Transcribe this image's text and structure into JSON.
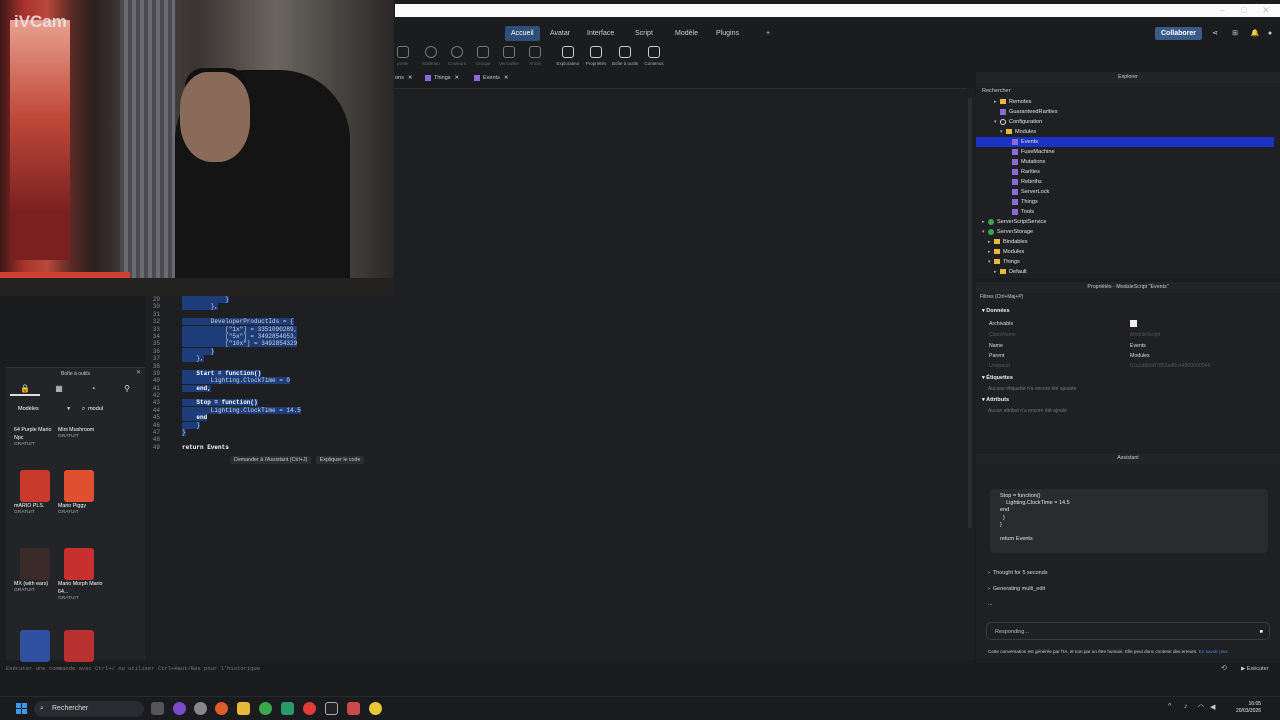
{
  "webcam": {
    "brand": "iVCam"
  },
  "menu": {
    "tabs": [
      "Accueil",
      "Avatar",
      "Interface",
      "Script",
      "Modèle",
      "Plugins"
    ],
    "add": "+",
    "collab": "Collaborer"
  },
  "ribbon": {
    "items": [
      "porter",
      "Matériau",
      "Couleurs",
      "Groupe",
      "Verrouiller",
      "Ancré",
      "Explorateur",
      "Propriétés",
      "Boîte à outils",
      "Contenus"
    ]
  },
  "doctabs": [
    {
      "label": "ons"
    },
    {
      "label": "Things"
    },
    {
      "label": "Events"
    }
  ],
  "code": {
    "lines": [
      {
        "n": "29",
        "t": "            }"
      },
      {
        "n": "30",
        "t": "        },"
      },
      {
        "n": "31",
        "t": ""
      },
      {
        "n": "32",
        "t": "        DeveloperProductIds = {"
      },
      {
        "n": "33",
        "t": "            [\"1x\"] = 3351090289,"
      },
      {
        "n": "34",
        "t": "            [\"5x\"] = 3492854053,"
      },
      {
        "n": "35",
        "t": "            [\"10x\"] = 3492854329"
      },
      {
        "n": "36",
        "t": "        }"
      },
      {
        "n": "37",
        "t": "    },"
      },
      {
        "n": "38",
        "t": ""
      },
      {
        "n": "39",
        "t": "    Start = function()"
      },
      {
        "n": "40",
        "t": "        Lighting.ClockTime = 0"
      },
      {
        "n": "41",
        "t": "    end,"
      },
      {
        "n": "42",
        "t": ""
      },
      {
        "n": "43",
        "t": "    Stop = function()"
      },
      {
        "n": "44",
        "t": "        Lighting.ClockTime = 14.5"
      },
      {
        "n": "45",
        "t": "    end"
      },
      {
        "n": "46",
        "t": "    }"
      },
      {
        "n": "47",
        "t": "}"
      },
      {
        "n": "48",
        "t": ""
      },
      {
        "n": "49",
        "t": "return Events"
      }
    ],
    "ai_ask": "Demander à l'Assistant (Ctrl+J)",
    "ai_explain": "Expliquer le code"
  },
  "toolbox": {
    "title": "Boîte à outils",
    "category": "Modèles",
    "search": "modul",
    "items": [
      {
        "name": "64 Purple Mario Npc",
        "price": "GRATUIT",
        "color": "#2a2b2f"
      },
      {
        "name": "Mini Mushroom",
        "price": "GRATUIT",
        "color": "#2a2b2f"
      },
      {
        "name": "mARIO PLS.",
        "price": "GRATUIT",
        "color": "#c83a2a"
      },
      {
        "name": "Mario Piggy",
        "price": "GRATUIT",
        "color": "#e05030"
      },
      {
        "name": "MX (with ears)",
        "price": "GRATUIT",
        "color": "#3a2a2a"
      },
      {
        "name": "Mario Morph Mario 64...",
        "price": "GRATUIT",
        "color": "#c83030"
      },
      {
        "name": "",
        "price": "",
        "color": "#3050a0"
      },
      {
        "name": "",
        "price": "",
        "color": "#b83030"
      }
    ]
  },
  "cmdbar": {
    "text": "Exécuter une commande avec Ctrl+/ ou utiliser Ctrl+Haut/Bas pour l'historique",
    "run": "Exécuter"
  },
  "explorer": {
    "title": "Explorer",
    "search": "Rechercher",
    "rows": [
      {
        "label": "Remotes",
        "icon": "folder",
        "indent": 2,
        "arrow": "▸",
        "sel": false
      },
      {
        "label": "GuaranteedRarities",
        "icon": "module",
        "indent": 2,
        "arrow": "",
        "sel": false
      },
      {
        "label": "Configuration",
        "icon": "config",
        "indent": 2,
        "arrow": "▾",
        "sel": false
      },
      {
        "label": "Modules",
        "icon": "folder",
        "indent": 3,
        "arrow": "▾",
        "sel": false
      },
      {
        "label": "Events",
        "icon": "module",
        "indent": 4,
        "arrow": "",
        "sel": true
      },
      {
        "label": "FuseMachine",
        "icon": "module",
        "indent": 4,
        "arrow": "",
        "sel": false
      },
      {
        "label": "Mutations",
        "icon": "module",
        "indent": 4,
        "arrow": "",
        "sel": false
      },
      {
        "label": "Rarities",
        "icon": "module",
        "indent": 4,
        "arrow": "",
        "sel": false
      },
      {
        "label": "Rebirths",
        "icon": "module",
        "indent": 4,
        "arrow": "",
        "sel": false
      },
      {
        "label": "ServerLock",
        "icon": "module",
        "indent": 4,
        "arrow": "",
        "sel": false
      },
      {
        "label": "Things",
        "icon": "module",
        "indent": 4,
        "arrow": "",
        "sel": false
      },
      {
        "label": "Tools",
        "icon": "module",
        "indent": 4,
        "arrow": "",
        "sel": false
      },
      {
        "label": "ServerScriptService",
        "icon": "service",
        "indent": 0,
        "arrow": "▸",
        "sel": false
      },
      {
        "label": "ServerStorage",
        "icon": "service",
        "indent": 0,
        "arrow": "▾",
        "sel": false
      },
      {
        "label": "Bindables",
        "icon": "folder",
        "indent": 1,
        "arrow": "▸",
        "sel": false
      },
      {
        "label": "Modules",
        "icon": "folder",
        "indent": 1,
        "arrow": "▸",
        "sel": false
      },
      {
        "label": "Things",
        "icon": "folder",
        "indent": 1,
        "arrow": "▾",
        "sel": false
      },
      {
        "label": "Default",
        "icon": "folder",
        "indent": 2,
        "arrow": "▸",
        "sel": false
      }
    ]
  },
  "props": {
    "title": "Propriétés - ModuleScript \"Events\"",
    "filter": "Filtres (Ctrl+Maj+P)",
    "sec_data": "Données",
    "archivable": "Archivable",
    "classname": "ClassName",
    "classname_v": "ModuleScript",
    "name": "Name",
    "name_v": "Events",
    "parent": "Parent",
    "parent_v": "Modules",
    "uniqueid": "UniqueId",
    "uniqueid_v": "51a1d8b587853ad6c44860000946",
    "sec_tags": "Étiquettes",
    "tags_note": "Aucune étiquette n'a encore été ajoutée",
    "sec_attr": "Attributs",
    "attr_note": "Aucun attribut n'a encore été ajouté"
  },
  "assistant": {
    "title": "Assistant",
    "code": "Stop = function()\n    Lighting.ClockTime = 14.5\nend\n  }\n}\n\nreturn Events",
    "thought": "Thought for 5 seconds",
    "generating": "Generating multi_edit",
    "dots": "...",
    "input": "Responding...",
    "footer": "Cette conversation est générée par l'IA, et non par un être humain. Elle peut donc contenir des erreurs.",
    "footer_link": "En savoir plus"
  },
  "taskbar": {
    "search": "Rechercher",
    "time": "16:05",
    "date": "20/03/2026"
  }
}
